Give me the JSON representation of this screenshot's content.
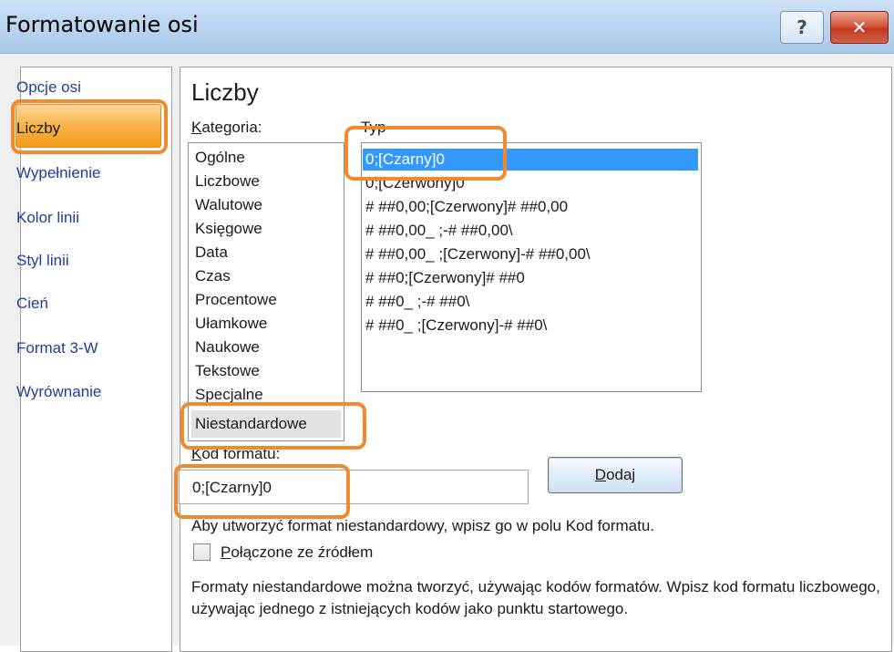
{
  "window": {
    "title": "Formatowanie osi",
    "help_label": "?",
    "close_label": "✕"
  },
  "nav": {
    "items": [
      {
        "label": "Opcje osi",
        "selected": false
      },
      {
        "label": "Liczby",
        "selected": true
      },
      {
        "label": "Wypełnienie",
        "selected": false
      },
      {
        "label": "Kolor linii",
        "selected": false
      },
      {
        "label": "Styl linii",
        "selected": false
      },
      {
        "label": "Cień",
        "selected": false
      },
      {
        "label": "Format 3-W",
        "selected": false
      },
      {
        "label": "Wyrównanie",
        "selected": false
      }
    ]
  },
  "main": {
    "section_title": "Liczby",
    "category_label": "Kategoria:",
    "type_label": "Typ",
    "categories": [
      "Ogólne",
      "Liczbowe",
      "Walutowe",
      "Księgowe",
      "Data",
      "Czas",
      "Procentowe",
      "Ułamkowe",
      "Naukowe",
      "Tekstowe",
      "Specjalne",
      "Niestandardowe"
    ],
    "selected_category": "Niestandardowe",
    "types": [
      "0;[Czarny]0",
      "0;[Czerwony]0",
      "# ##0,00;[Czerwony]# ##0,00",
      "# ##0,00_ ;-# ##0,00\\",
      "# ##0,00_ ;[Czerwony]-# ##0,00\\",
      "# ##0;[Czerwony]# ##0",
      "# ##0_ ;-# ##0\\",
      "# ##0_ ;[Czerwony]-# ##0\\"
    ],
    "selected_type": "0;[Czarny]0",
    "format_code_label": "Kod formatu:",
    "format_code_value": "0;[Czarny]0",
    "add_button": "Dodaj",
    "hint_text": "Aby utworzyć format niestandardowy, wpisz go w polu Kod formatu.",
    "linked_checkbox_label": "Połączone ze źródłem",
    "linked_checked": false,
    "description": "Formaty niestandardowe można tworzyć, używając kodów formatów. Wpisz kod formatu liczbowego, używając jednego z istniejących kodów jako punktu startowego."
  },
  "colors": {
    "highlight": "#f08a2e",
    "selection": "#3399ff",
    "nav_link": "#1e3e9c"
  }
}
